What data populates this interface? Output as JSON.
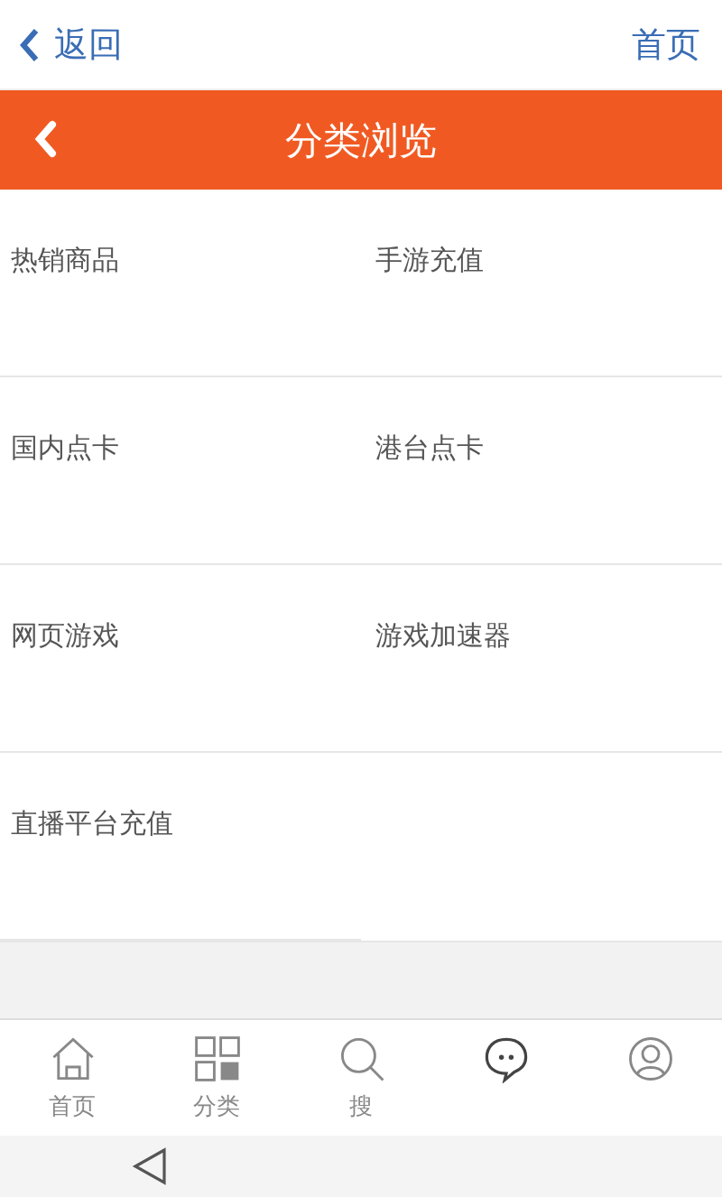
{
  "top_bar": {
    "back_label": "返回",
    "home_link": "首页"
  },
  "header": {
    "title": "分类浏览"
  },
  "categories": [
    {
      "label": "热销商品"
    },
    {
      "label": "手游充值"
    },
    {
      "label": "国内点卡"
    },
    {
      "label": "港台点卡"
    },
    {
      "label": "网页游戏"
    },
    {
      "label": "游戏加速器"
    },
    {
      "label": "直播平台充值"
    }
  ],
  "tab_bar": [
    {
      "kind": "home",
      "label": "首页"
    },
    {
      "kind": "grid",
      "label": "分类"
    },
    {
      "kind": "search",
      "label": "搜"
    },
    {
      "kind": "chat"
    },
    {
      "kind": "user"
    }
  ]
}
